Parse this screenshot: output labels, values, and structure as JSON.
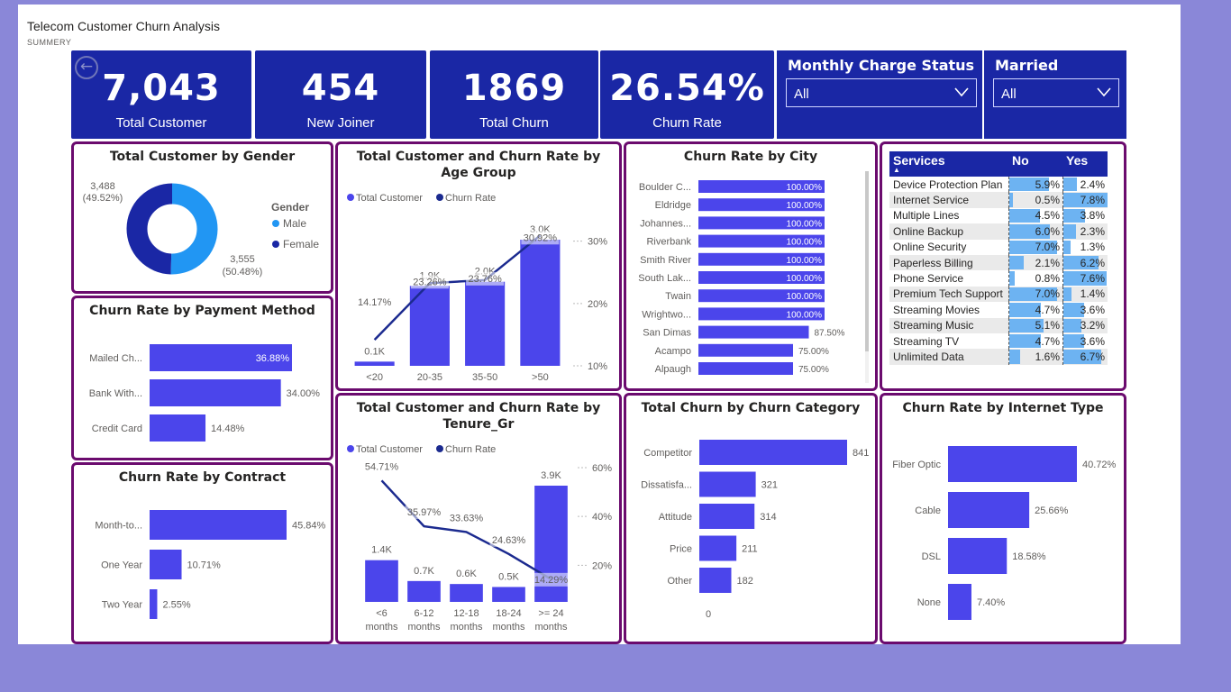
{
  "header": {
    "title": "Telecom Customer Churn Analysis",
    "subtitle": "SUMMERY"
  },
  "kpis": [
    {
      "value": "7,043",
      "label": "Total Customer"
    },
    {
      "value": "454",
      "label": "New Joiner"
    },
    {
      "value": "1869",
      "label": "Total Churn"
    },
    {
      "value": "26.54%",
      "label": "Churn Rate"
    }
  ],
  "slicers": [
    {
      "title": "Monthly Charge Status",
      "value": "All"
    },
    {
      "title": "Married",
      "value": "All"
    }
  ],
  "colors": {
    "kpi_bg": "#1a27a5",
    "bar": "#4b45eb",
    "line": "#1b2a8f",
    "border": "#6b0b6e",
    "male": "#2196f3",
    "female": "#1a27a5",
    "data_bar": "#6db3f2"
  },
  "chart_data": [
    {
      "id": "gender",
      "type": "pie",
      "title": "Total Customer by Gender",
      "legend_title": "Gender",
      "slices": [
        {
          "name": "Male",
          "value": 3555,
          "label": "3,555",
          "pct": "(50.48%)"
        },
        {
          "name": "Female",
          "value": 3488,
          "label": "3,488",
          "pct": "(49.52%)"
        }
      ]
    },
    {
      "id": "payment",
      "type": "bar",
      "title": "Churn Rate by Payment Method",
      "categories": [
        "Mailed Ch...",
        "Bank With...",
        "Credit Card"
      ],
      "values": [
        36.88,
        34.0,
        14.48
      ],
      "labels": [
        "36.88%",
        "34.00%",
        "14.48%"
      ]
    },
    {
      "id": "contract",
      "type": "bar",
      "title": "Churn Rate by Contract",
      "categories": [
        "Month-to...",
        "One Year",
        "Two Year"
      ],
      "values": [
        45.84,
        10.71,
        2.55
      ],
      "labels": [
        "45.84%",
        "10.71%",
        "2.55%"
      ]
    },
    {
      "id": "age",
      "type": "bar",
      "title": "Total Customer and Churn Rate by Age Group",
      "series": [
        {
          "name": "Total Customer",
          "values": [
            100,
            1900,
            2000,
            3000
          ],
          "labels": [
            "0.1K",
            "1.9K",
            "2.0K",
            "3.0K"
          ]
        },
        {
          "name": "Churn Rate",
          "values": [
            14.17,
            23.26,
            23.76,
            30.92
          ],
          "labels": [
            "14.17%",
            "23.26%",
            "23.76%",
            "30.92%"
          ]
        }
      ],
      "categories": [
        "<20",
        "20-35",
        "35-50",
        ">50"
      ],
      "y2_ticks": [
        "10%",
        "20%",
        "30%"
      ],
      "y2_range": [
        10,
        34
      ]
    },
    {
      "id": "tenure",
      "type": "bar",
      "title": "Total Customer and Churn Rate by Tenure_Gr",
      "series": [
        {
          "name": "Total Customer",
          "values": [
            1400,
            700,
            600,
            500,
            3900
          ],
          "labels": [
            "1.4K",
            "0.7K",
            "0.6K",
            "0.5K",
            "3.9K"
          ]
        },
        {
          "name": "Churn Rate",
          "values": [
            54.71,
            35.97,
            33.63,
            24.63,
            14.29
          ],
          "labels": [
            "54.71%",
            "35.97%",
            "33.63%",
            "24.63%",
            "14.29%"
          ]
        }
      ],
      "categories": [
        [
          "<6",
          "months"
        ],
        [
          "6-12",
          "months"
        ],
        [
          "12-18",
          "months"
        ],
        [
          "18-24",
          "months"
        ],
        [
          ">= 24",
          "months"
        ]
      ],
      "y2_ticks": [
        "20%",
        "40%",
        "60%"
      ],
      "y2_range": [
        5,
        60
      ]
    },
    {
      "id": "city",
      "type": "bar",
      "title": "Churn Rate by City",
      "categories": [
        "Boulder C...",
        "Eldridge",
        "Johannes...",
        "Riverbank",
        "Smith River",
        "South Lak...",
        "Twain",
        "Wrightwo...",
        "San Dimas",
        "Acampo",
        "Alpaugh"
      ],
      "values": [
        100,
        100,
        100,
        100,
        100,
        100,
        100,
        100,
        87.5,
        75,
        75
      ],
      "labels": [
        "100.00%",
        "100.00%",
        "100.00%",
        "100.00%",
        "100.00%",
        "100.00%",
        "100.00%",
        "100.00%",
        "87.50%",
        "75.00%",
        "75.00%"
      ]
    },
    {
      "id": "category",
      "type": "bar",
      "title": "Total Churn by Churn Category",
      "categories": [
        "Competitor",
        "Dissatisfa...",
        "Attitude",
        "Price",
        "Other"
      ],
      "values": [
        841,
        321,
        314,
        211,
        182
      ],
      "labels": [
        "841",
        "321",
        "314",
        "211",
        "182"
      ],
      "axis_label": "0"
    },
    {
      "id": "internet",
      "type": "bar",
      "title": "Churn Rate by Internet Type",
      "categories": [
        "Fiber Optic",
        "Cable",
        "DSL",
        "None"
      ],
      "values": [
        40.72,
        25.66,
        18.58,
        7.4
      ],
      "labels": [
        "40.72%",
        "25.66%",
        "18.58%",
        "7.40%"
      ]
    },
    {
      "id": "services",
      "type": "table",
      "columns": [
        "Services",
        "No",
        "Yes"
      ],
      "rows": [
        {
          "name": "Device Protection Plan",
          "no": "5.9%",
          "yes": "2.4%",
          "no_v": 5.9,
          "yes_v": 2.4
        },
        {
          "name": "Internet Service",
          "no": "0.5%",
          "yes": "7.8%",
          "no_v": 0.5,
          "yes_v": 7.8
        },
        {
          "name": "Multiple Lines",
          "no": "4.5%",
          "yes": "3.8%",
          "no_v": 4.5,
          "yes_v": 3.8
        },
        {
          "name": "Online Backup",
          "no": "6.0%",
          "yes": "2.3%",
          "no_v": 6.0,
          "yes_v": 2.3
        },
        {
          "name": "Online Security",
          "no": "7.0%",
          "yes": "1.3%",
          "no_v": 7.0,
          "yes_v": 1.3
        },
        {
          "name": "Paperless Billing",
          "no": "2.1%",
          "yes": "6.2%",
          "no_v": 2.1,
          "yes_v": 6.2
        },
        {
          "name": "Phone Service",
          "no": "0.8%",
          "yes": "7.6%",
          "no_v": 0.8,
          "yes_v": 7.6
        },
        {
          "name": "Premium Tech Support",
          "no": "7.0%",
          "yes": "1.4%",
          "no_v": 7.0,
          "yes_v": 1.4
        },
        {
          "name": "Streaming Movies",
          "no": "4.7%",
          "yes": "3.6%",
          "no_v": 4.7,
          "yes_v": 3.6
        },
        {
          "name": "Streaming Music",
          "no": "5.1%",
          "yes": "3.2%",
          "no_v": 5.1,
          "yes_v": 3.2
        },
        {
          "name": "Streaming TV",
          "no": "4.7%",
          "yes": "3.6%",
          "no_v": 4.7,
          "yes_v": 3.6
        },
        {
          "name": "Unlimited Data",
          "no": "1.6%",
          "yes": "6.7%",
          "no_v": 1.6,
          "yes_v": 6.7
        }
      ]
    }
  ]
}
